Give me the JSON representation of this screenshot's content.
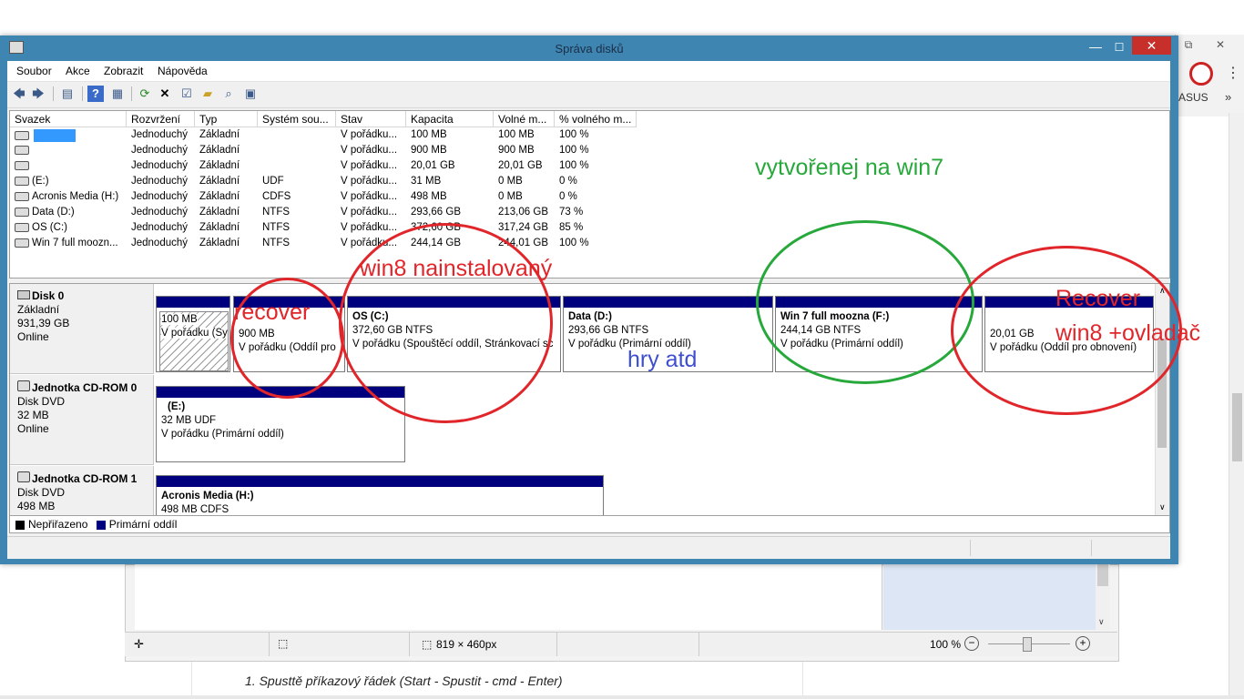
{
  "window": {
    "title": "Správa disků",
    "controls": {
      "minimize": "—",
      "maximize": "☐",
      "close": "✕"
    }
  },
  "menu": [
    "Soubor",
    "Akce",
    "Zobrazit",
    "Nápověda"
  ],
  "volume_list": {
    "columns": [
      "Svazek",
      "Rozvržení",
      "Typ",
      "Systém sou...",
      "Stav",
      "Kapacita",
      "Volné m...",
      "% volného m..."
    ],
    "rows": [
      {
        "name": "",
        "layout": "Jednoduchý",
        "type": "Základní",
        "fs": "",
        "status": "V pořádku...",
        "capacity": "100 MB",
        "free": "100 MB",
        "pct": "100 %"
      },
      {
        "name": "",
        "layout": "Jednoduchý",
        "type": "Základní",
        "fs": "",
        "status": "V pořádku...",
        "capacity": "900 MB",
        "free": "900 MB",
        "pct": "100 %"
      },
      {
        "name": "",
        "layout": "Jednoduchý",
        "type": "Základní",
        "fs": "",
        "status": "V pořádku...",
        "capacity": "20,01 GB",
        "free": "20,01 GB",
        "pct": "100 %"
      },
      {
        "name": "(E:)",
        "layout": "Jednoduchý",
        "type": "Základní",
        "fs": "UDF",
        "status": "V pořádku...",
        "capacity": "31 MB",
        "free": "0 MB",
        "pct": "0 %"
      },
      {
        "name": "Acronis Media (H:)",
        "layout": "Jednoduchý",
        "type": "Základní",
        "fs": "CDFS",
        "status": "V pořádku...",
        "capacity": "498 MB",
        "free": "0 MB",
        "pct": "0 %"
      },
      {
        "name": "Data (D:)",
        "layout": "Jednoduchý",
        "type": "Základní",
        "fs": "NTFS",
        "status": "V pořádku...",
        "capacity": "293,66 GB",
        "free": "213,06 GB",
        "pct": "73 %"
      },
      {
        "name": "OS (C:)",
        "layout": "Jednoduchý",
        "type": "Základní",
        "fs": "NTFS",
        "status": "V pořádku...",
        "capacity": "372,60 GB",
        "free": "317,24 GB",
        "pct": "85 %"
      },
      {
        "name": "Win 7 full  moozn...",
        "layout": "Jednoduchý",
        "type": "Základní",
        "fs": "NTFS",
        "status": "V pořádku...",
        "capacity": "244,14 GB",
        "free": "244,01 GB",
        "pct": "100 %"
      }
    ]
  },
  "disks": [
    {
      "name": "Disk 0",
      "line1": "Základní",
      "line2": "931,39 GB",
      "line3": "Online"
    },
    {
      "name": "Jednotka CD-ROM 0",
      "line1": "Disk DVD",
      "line2": "32 MB",
      "line3": "Online"
    },
    {
      "name": "Jednotka CD-ROM 1",
      "line1": "Disk DVD",
      "line2": "498 MB",
      "line3": ""
    }
  ],
  "partitions": {
    "p1": {
      "title": "",
      "size": "100 MB",
      "status": "V pořádku (Sy"
    },
    "p2": {
      "title": "",
      "size": "900 MB",
      "status": "V pořádku (Oddíl pro"
    },
    "p3": {
      "title": "OS  (C:)",
      "size": "372,60 GB NTFS",
      "status": "V pořádku (Spouštěcí oddíl, Stránkovací sc"
    },
    "p4": {
      "title": "Data  (D:)",
      "size": "293,66 GB NTFS",
      "status": "V pořádku (Primární oddíl)"
    },
    "p5": {
      "title": "Win 7 full  moozna  (F:)",
      "size": "244,14 GB NTFS",
      "status": "V pořádku (Primární oddíl)"
    },
    "p6": {
      "title": "",
      "size": "20,01 GB",
      "status": "V pořádku (Oddíl pro obnovení)"
    },
    "cd0": {
      "title": "(E:)",
      "size": "32 MB UDF",
      "status": "V pořádku (Primární oddíl)"
    },
    "cd1": {
      "title": "Acronis Media  (H:)",
      "size": "498 MB CDFS",
      "status": ""
    }
  },
  "legend": {
    "unallocated": "Nepřiřazeno",
    "primary": "Primární oddíl",
    "colors": {
      "unallocated": "#000000",
      "primary": "#00007e"
    }
  },
  "annotations": {
    "green_text": "vytvořenej na win7",
    "installed": "win8 nainstalovaný",
    "recover_small": "recover",
    "recover_right": "Recover",
    "recover_right2": "win8 +ovladač",
    "games": "hry atd",
    "colors": {
      "red": "#e0262a",
      "green": "#27a83a",
      "blue": "#3d4fcf"
    }
  },
  "background": {
    "asus_label": "ASUS",
    "chevron": "»",
    "dimensions": "819 × 460px",
    "zoom": "100 %",
    "doc_text": "1. Spusttě příkazový řádek (Start - Spustit - cmd - Enter)"
  }
}
